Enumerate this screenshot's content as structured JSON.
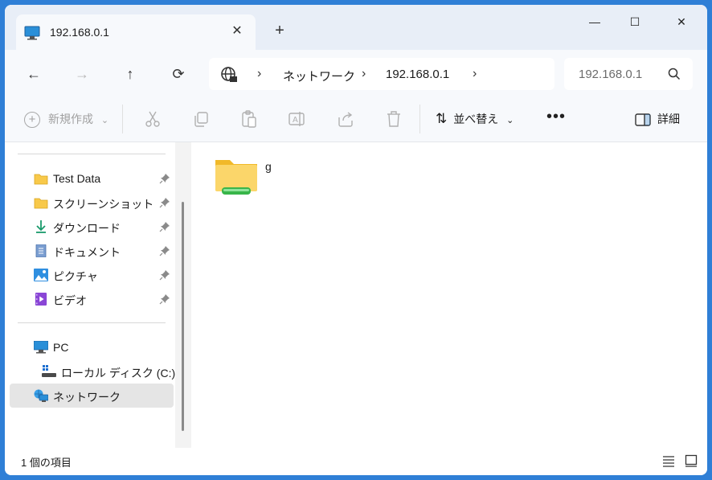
{
  "tab": {
    "title": "192.168.0.1",
    "close_glyph": "✕",
    "new_tab_glyph": "+"
  },
  "window_controls": {
    "minimize": "—",
    "maximize": "☐",
    "close": "✕"
  },
  "nav": {
    "back": "←",
    "forward": "→",
    "up": "↑",
    "refresh": "⟳"
  },
  "address": {
    "crumbs": [
      "ネットワーク",
      "192.168.0.1"
    ],
    "separator": "›"
  },
  "search": {
    "value": "192.168.0.1"
  },
  "toolbar": {
    "new_label": "新規作成",
    "sort_label": "並べ替え",
    "more": "•••",
    "details_label": "詳細",
    "dropdown": "⌄"
  },
  "sidebar": {
    "quick_access": [
      {
        "label": "Test Data",
        "icon": "folder-icon"
      },
      {
        "label": "スクリーンショット",
        "icon": "folder-icon"
      },
      {
        "label": "ダウンロード",
        "icon": "download-icon"
      },
      {
        "label": "ドキュメント",
        "icon": "document-icon"
      },
      {
        "label": "ピクチャ",
        "icon": "pictures-icon"
      },
      {
        "label": "ビデオ",
        "icon": "videos-icon"
      }
    ],
    "pc": "PC",
    "local_disk": "ローカル ディスク (C:)",
    "network": "ネットワーク"
  },
  "content": {
    "items": [
      {
        "name": "g",
        "icon": "shared-folder-icon"
      }
    ]
  },
  "status": {
    "count_text": "1 個の項目"
  },
  "colors": {
    "accent": "#0067c0",
    "folder": "#f8c94a",
    "selection": "#e5e5e5"
  }
}
